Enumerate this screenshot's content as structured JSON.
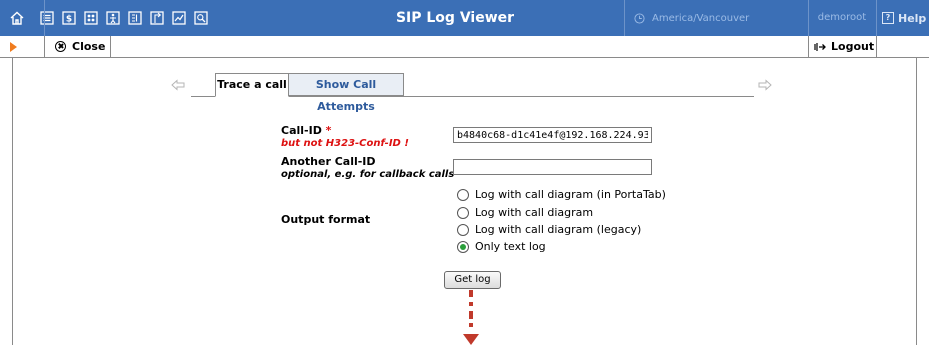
{
  "header": {
    "title": "SIP Log Viewer",
    "timezone": "America/Vancouver",
    "user": "demoroot",
    "help_label": "Help",
    "nav_icons": [
      "home-icon",
      "list-icon",
      "dollar-icon",
      "grid-icon",
      "person-icon",
      "directory-icon",
      "forward-icon",
      "chart-icon",
      "search-icon"
    ]
  },
  "toolbar": {
    "close_label": "Close",
    "logout_label": "Logout"
  },
  "tabs": [
    {
      "label": "Trace a call",
      "active": true
    },
    {
      "label": "Show Call Attempts",
      "active": false
    }
  ],
  "form": {
    "call_id": {
      "label": "Call-ID",
      "required_mark": "*",
      "note": "but not H323-Conf-ID !",
      "value": "b4840c68-d1c41e4f@192.168.224.93"
    },
    "another_call_id": {
      "label": "Another Call-ID",
      "note": "optional, e.g. for callback calls",
      "value": ""
    },
    "output_format": {
      "label": "Output format",
      "options": [
        {
          "label": "Log with call diagram (in PortaTab)",
          "checked": false
        },
        {
          "label": "Log with call diagram",
          "checked": false
        },
        {
          "label": "Log with call diagram (legacy)",
          "checked": false
        },
        {
          "label": "Only text log",
          "checked": true
        }
      ]
    },
    "submit_label": "Get log"
  },
  "colors": {
    "header_bg": "#3b6fb6",
    "required": "#dd1111",
    "annotation_arrow": "#c0392b",
    "tab_link": "#2d5a9c"
  }
}
